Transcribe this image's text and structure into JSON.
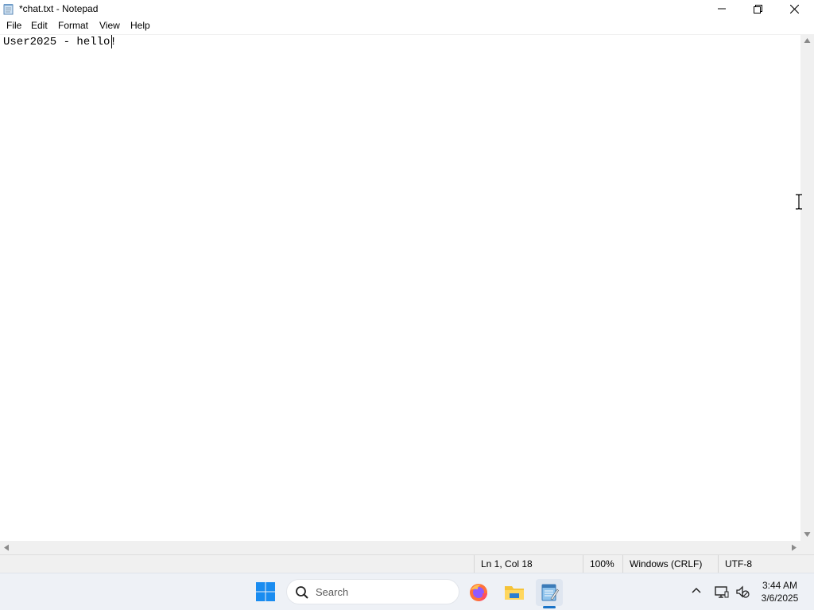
{
  "window": {
    "title": "*chat.txt - Notepad"
  },
  "menu": {
    "items": [
      "File",
      "Edit",
      "Format",
      "View",
      "Help"
    ]
  },
  "editor": {
    "content": "User2025 - hello!"
  },
  "status": {
    "position": "Ln 1, Col 18",
    "zoom": "100%",
    "line_ending": "Windows (CRLF)",
    "encoding": "UTF-8"
  },
  "taskbar": {
    "search_placeholder": "Search",
    "pinned_apps": [
      "firefox-icon",
      "file-explorer-icon",
      "notepad-icon"
    ],
    "active_app": "notepad-icon",
    "clock": {
      "time": "3:44 AM",
      "date": "3/6/2025"
    }
  },
  "colors": {
    "accent": "#1a73c7",
    "chrome": "#f0f0f0",
    "taskbar": "#eef1f6"
  }
}
